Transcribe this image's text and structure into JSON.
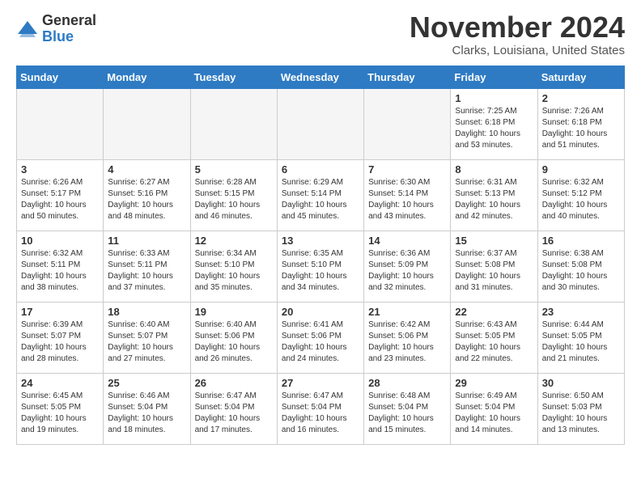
{
  "header": {
    "logo_general": "General",
    "logo_blue": "Blue",
    "month_title": "November 2024",
    "location": "Clarks, Louisiana, United States"
  },
  "weekdays": [
    "Sunday",
    "Monday",
    "Tuesday",
    "Wednesday",
    "Thursday",
    "Friday",
    "Saturday"
  ],
  "weeks": [
    [
      {
        "day": "",
        "empty": true
      },
      {
        "day": "",
        "empty": true
      },
      {
        "day": "",
        "empty": true
      },
      {
        "day": "",
        "empty": true
      },
      {
        "day": "",
        "empty": true
      },
      {
        "day": "1",
        "sunrise": "Sunrise: 7:25 AM",
        "sunset": "Sunset: 6:18 PM",
        "daylight": "Daylight: 10 hours and 53 minutes."
      },
      {
        "day": "2",
        "sunrise": "Sunrise: 7:26 AM",
        "sunset": "Sunset: 6:18 PM",
        "daylight": "Daylight: 10 hours and 51 minutes."
      }
    ],
    [
      {
        "day": "3",
        "sunrise": "Sunrise: 6:26 AM",
        "sunset": "Sunset: 5:17 PM",
        "daylight": "Daylight: 10 hours and 50 minutes."
      },
      {
        "day": "4",
        "sunrise": "Sunrise: 6:27 AM",
        "sunset": "Sunset: 5:16 PM",
        "daylight": "Daylight: 10 hours and 48 minutes."
      },
      {
        "day": "5",
        "sunrise": "Sunrise: 6:28 AM",
        "sunset": "Sunset: 5:15 PM",
        "daylight": "Daylight: 10 hours and 46 minutes."
      },
      {
        "day": "6",
        "sunrise": "Sunrise: 6:29 AM",
        "sunset": "Sunset: 5:14 PM",
        "daylight": "Daylight: 10 hours and 45 minutes."
      },
      {
        "day": "7",
        "sunrise": "Sunrise: 6:30 AM",
        "sunset": "Sunset: 5:14 PM",
        "daylight": "Daylight: 10 hours and 43 minutes."
      },
      {
        "day": "8",
        "sunrise": "Sunrise: 6:31 AM",
        "sunset": "Sunset: 5:13 PM",
        "daylight": "Daylight: 10 hours and 42 minutes."
      },
      {
        "day": "9",
        "sunrise": "Sunrise: 6:32 AM",
        "sunset": "Sunset: 5:12 PM",
        "daylight": "Daylight: 10 hours and 40 minutes."
      }
    ],
    [
      {
        "day": "10",
        "sunrise": "Sunrise: 6:32 AM",
        "sunset": "Sunset: 5:11 PM",
        "daylight": "Daylight: 10 hours and 38 minutes."
      },
      {
        "day": "11",
        "sunrise": "Sunrise: 6:33 AM",
        "sunset": "Sunset: 5:11 PM",
        "daylight": "Daylight: 10 hours and 37 minutes."
      },
      {
        "day": "12",
        "sunrise": "Sunrise: 6:34 AM",
        "sunset": "Sunset: 5:10 PM",
        "daylight": "Daylight: 10 hours and 35 minutes."
      },
      {
        "day": "13",
        "sunrise": "Sunrise: 6:35 AM",
        "sunset": "Sunset: 5:10 PM",
        "daylight": "Daylight: 10 hours and 34 minutes."
      },
      {
        "day": "14",
        "sunrise": "Sunrise: 6:36 AM",
        "sunset": "Sunset: 5:09 PM",
        "daylight": "Daylight: 10 hours and 32 minutes."
      },
      {
        "day": "15",
        "sunrise": "Sunrise: 6:37 AM",
        "sunset": "Sunset: 5:08 PM",
        "daylight": "Daylight: 10 hours and 31 minutes."
      },
      {
        "day": "16",
        "sunrise": "Sunrise: 6:38 AM",
        "sunset": "Sunset: 5:08 PM",
        "daylight": "Daylight: 10 hours and 30 minutes."
      }
    ],
    [
      {
        "day": "17",
        "sunrise": "Sunrise: 6:39 AM",
        "sunset": "Sunset: 5:07 PM",
        "daylight": "Daylight: 10 hours and 28 minutes."
      },
      {
        "day": "18",
        "sunrise": "Sunrise: 6:40 AM",
        "sunset": "Sunset: 5:07 PM",
        "daylight": "Daylight: 10 hours and 27 minutes."
      },
      {
        "day": "19",
        "sunrise": "Sunrise: 6:40 AM",
        "sunset": "Sunset: 5:06 PM",
        "daylight": "Daylight: 10 hours and 26 minutes."
      },
      {
        "day": "20",
        "sunrise": "Sunrise: 6:41 AM",
        "sunset": "Sunset: 5:06 PM",
        "daylight": "Daylight: 10 hours and 24 minutes."
      },
      {
        "day": "21",
        "sunrise": "Sunrise: 6:42 AM",
        "sunset": "Sunset: 5:06 PM",
        "daylight": "Daylight: 10 hours and 23 minutes."
      },
      {
        "day": "22",
        "sunrise": "Sunrise: 6:43 AM",
        "sunset": "Sunset: 5:05 PM",
        "daylight": "Daylight: 10 hours and 22 minutes."
      },
      {
        "day": "23",
        "sunrise": "Sunrise: 6:44 AM",
        "sunset": "Sunset: 5:05 PM",
        "daylight": "Daylight: 10 hours and 21 minutes."
      }
    ],
    [
      {
        "day": "24",
        "sunrise": "Sunrise: 6:45 AM",
        "sunset": "Sunset: 5:05 PM",
        "daylight": "Daylight: 10 hours and 19 minutes."
      },
      {
        "day": "25",
        "sunrise": "Sunrise: 6:46 AM",
        "sunset": "Sunset: 5:04 PM",
        "daylight": "Daylight: 10 hours and 18 minutes."
      },
      {
        "day": "26",
        "sunrise": "Sunrise: 6:47 AM",
        "sunset": "Sunset: 5:04 PM",
        "daylight": "Daylight: 10 hours and 17 minutes."
      },
      {
        "day": "27",
        "sunrise": "Sunrise: 6:47 AM",
        "sunset": "Sunset: 5:04 PM",
        "daylight": "Daylight: 10 hours and 16 minutes."
      },
      {
        "day": "28",
        "sunrise": "Sunrise: 6:48 AM",
        "sunset": "Sunset: 5:04 PM",
        "daylight": "Daylight: 10 hours and 15 minutes."
      },
      {
        "day": "29",
        "sunrise": "Sunrise: 6:49 AM",
        "sunset": "Sunset: 5:04 PM",
        "daylight": "Daylight: 10 hours and 14 minutes."
      },
      {
        "day": "30",
        "sunrise": "Sunrise: 6:50 AM",
        "sunset": "Sunset: 5:03 PM",
        "daylight": "Daylight: 10 hours and 13 minutes."
      }
    ]
  ]
}
